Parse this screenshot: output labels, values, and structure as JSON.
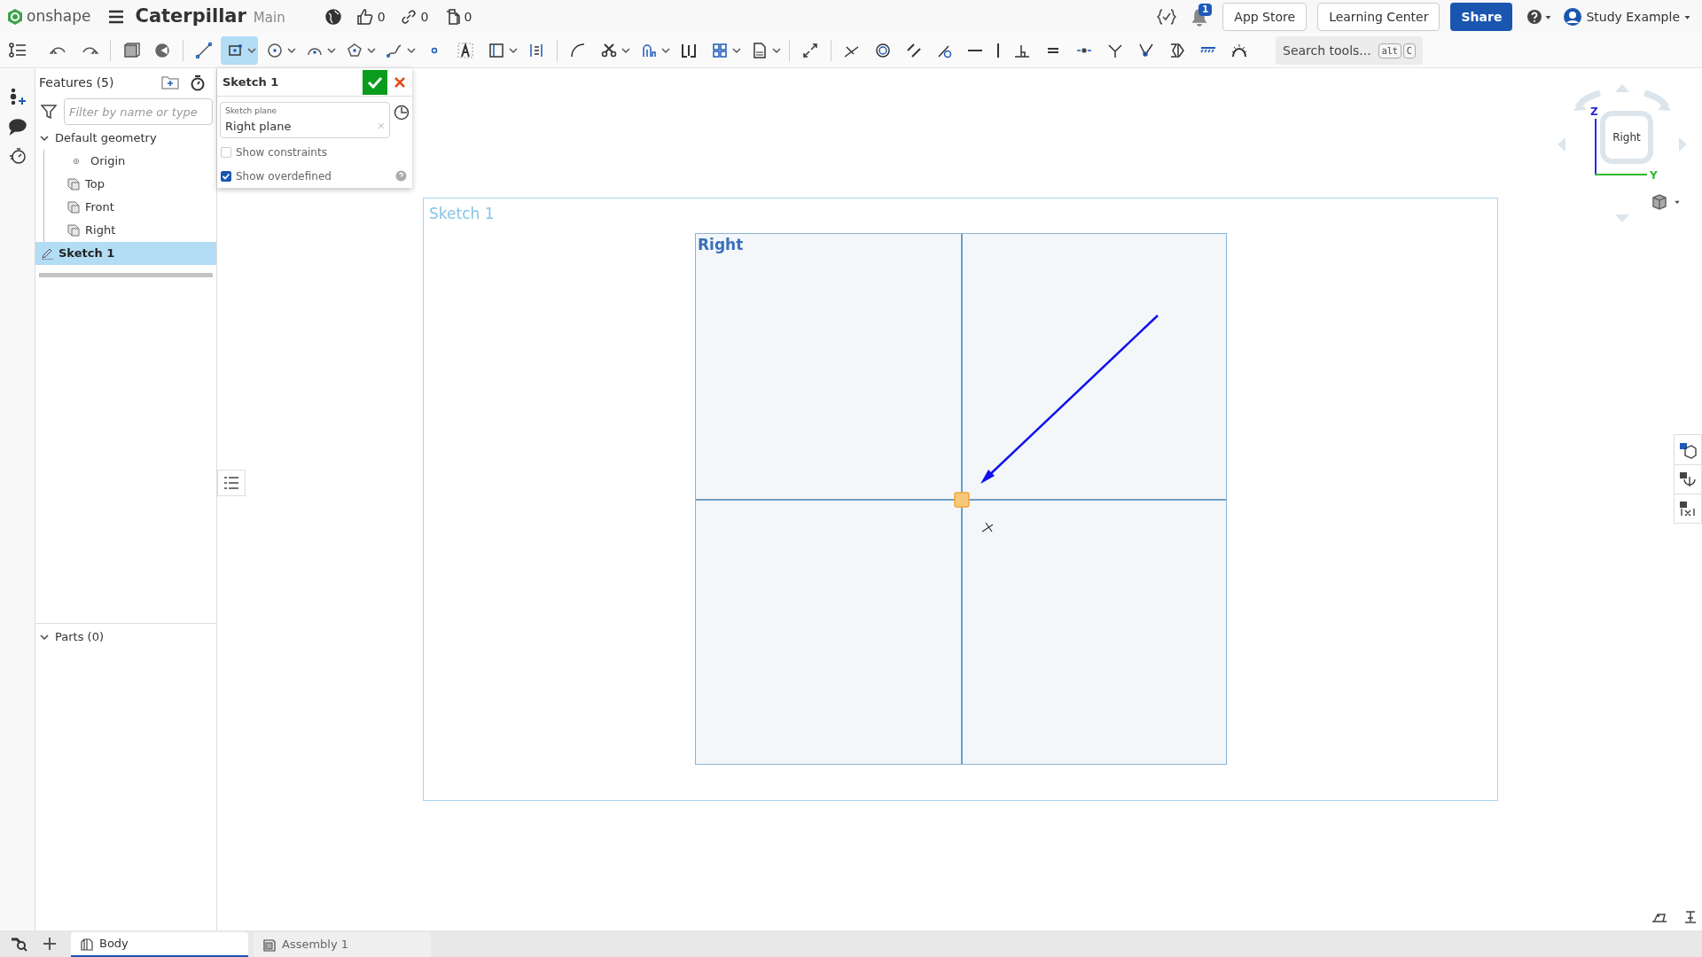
{
  "header": {
    "logo_text": "onshape",
    "document_title": "Caterpillar",
    "workspace": "Main",
    "likes": "0",
    "links": "0",
    "copies": "0",
    "notifications": "1",
    "buttons": [
      "App Store",
      "Learning Center"
    ],
    "share": "Share",
    "user": "Study Example"
  },
  "toolbar": [
    {
      "kind": "tool",
      "selected": false,
      "menu": false
    },
    {
      "kind": "tool",
      "selected": false,
      "menu": false
    },
    {
      "kind": "separator"
    },
    {
      "kind": "tool",
      "selected": false,
      "menu": false
    },
    {
      "kind": "tool",
      "selected": false,
      "menu": false
    },
    {
      "kind": "separator"
    },
    {
      "kind": "tool",
      "selected": false,
      "menu": false
    },
    {
      "kind": "tool",
      "selected": true,
      "menu": true
    },
    {
      "kind": "tool",
      "selected": false,
      "menu": true
    },
    {
      "kind": "tool",
      "selected": false,
      "menu": true
    },
    {
      "kind": "tool",
      "selected": false,
      "menu": true
    },
    {
      "kind": "tool",
      "selected": false,
      "menu": true
    },
    {
      "kind": "tool",
      "selected": false,
      "menu": false
    },
    {
      "kind": "tool",
      "selected": false,
      "menu": false
    },
    {
      "kind": "tool",
      "selected": false,
      "menu": true
    },
    {
      "kind": "tool",
      "selected": false,
      "menu": false
    },
    {
      "kind": "separator"
    },
    {
      "kind": "tool",
      "selected": false,
      "menu": false
    },
    {
      "kind": "tool",
      "selected": false,
      "menu": true
    },
    {
      "kind": "tool",
      "selected": false,
      "menu": true
    },
    {
      "kind": "tool",
      "selected": false,
      "menu": false
    },
    {
      "kind": "tool",
      "selected": false,
      "menu": true
    },
    {
      "kind": "tool",
      "selected": false,
      "menu": true
    },
    {
      "kind": "separator"
    },
    {
      "kind": "tool",
      "selected": false,
      "menu": false
    },
    {
      "kind": "separator"
    },
    {
      "kind": "tool",
      "selected": false,
      "menu": false
    },
    {
      "kind": "tool",
      "selected": false,
      "menu": false
    },
    {
      "kind": "tool",
      "selected": false,
      "menu": false
    },
    {
      "kind": "tool",
      "selected": false,
      "menu": false
    },
    {
      "kind": "tool",
      "selected": false,
      "menu": false
    },
    {
      "kind": "tool",
      "selected": false,
      "menu": false
    },
    {
      "kind": "tool",
      "selected": false,
      "menu": false
    },
    {
      "kind": "tool",
      "selected": false,
      "menu": false
    },
    {
      "kind": "tool",
      "selected": false,
      "menu": false
    },
    {
      "kind": "tool",
      "selected": false,
      "menu": false
    },
    {
      "kind": "tool",
      "selected": false,
      "menu": false
    },
    {
      "kind": "tool",
      "selected": false,
      "menu": false
    },
    {
      "kind": "tool",
      "selected": false,
      "menu": false
    },
    {
      "kind": "tool",
      "selected": false,
      "menu": false
    }
  ],
  "search_tools": {
    "placeholder": "Search tools...",
    "shortcut": [
      "alt",
      "C"
    ]
  },
  "features_panel": {
    "title": "Features (5)",
    "filter_placeholder": "Filter by name or type",
    "tree": [
      {
        "label": "Default geometry",
        "kind": "group",
        "expanded": true,
        "selected": false,
        "children": [
          {
            "label": "Origin",
            "kind": "point",
            "selected": false
          },
          {
            "label": "Top",
            "kind": "plane",
            "selected": false
          },
          {
            "label": "Front",
            "kind": "plane",
            "selected": false
          },
          {
            "label": "Right",
            "kind": "plane",
            "selected": false
          }
        ]
      },
      {
        "label": "Sketch 1",
        "kind": "sketch",
        "selected": true
      }
    ],
    "parts": {
      "label": "Parts (0)",
      "expanded": true
    }
  },
  "sketch_dialog": {
    "title": "Sketch 1",
    "plane_label": "Sketch plane",
    "plane_value": "Right plane",
    "options": [
      {
        "label": "Show constraints",
        "checked": false
      },
      {
        "label": "Show overdefined",
        "checked": true
      }
    ]
  },
  "canvas": {
    "sketch_label": "Sketch 1",
    "plane_label": "Right"
  },
  "view_cube": {
    "face": "Right",
    "axis_z": "Z",
    "axis_y": "Y"
  },
  "tabs": [
    {
      "label": "Body",
      "kind": "part_studio",
      "selected": true
    },
    {
      "label": "Assembly 1",
      "kind": "assembly",
      "selected": false
    }
  ]
}
